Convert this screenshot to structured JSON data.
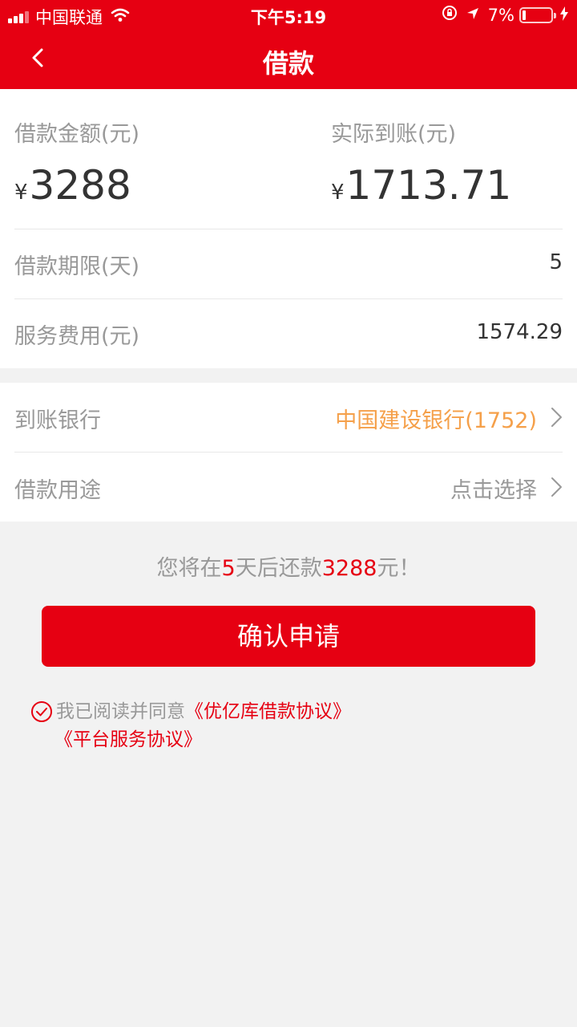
{
  "status_bar": {
    "carrier": "中国联通",
    "time": "下午5:19",
    "battery": "7%"
  },
  "nav": {
    "title": "借款"
  },
  "loan": {
    "amount_label": "借款金额(元)",
    "amount_currency": "¥",
    "amount_value": "3288",
    "received_label": "实际到账(元)",
    "received_currency": "¥",
    "received_value": "1713.71",
    "term_label": "借款期限(天)",
    "term_value": "5",
    "fee_label": "服务费用(元)",
    "fee_value": "1574.29"
  },
  "details": {
    "bank_label": "到账银行",
    "bank_value": "中国建设银行(1752)",
    "purpose_label": "借款用途",
    "purpose_value": "点击选择"
  },
  "notice": {
    "prefix": "您将在",
    "days": "5",
    "mid": "天后还款",
    "amount": "3288",
    "suffix": "元！"
  },
  "confirm_button": "确认申请",
  "agreement": {
    "text": "我已阅读并同意",
    "link1": "《优亿库借款协议》",
    "link2": "《平台服务协议》"
  },
  "colors": {
    "brand_red": "#e60012",
    "bank_orange": "#f5a04a",
    "label_gray": "#999999",
    "text_dark": "#333333",
    "background": "#f2f2f2"
  }
}
